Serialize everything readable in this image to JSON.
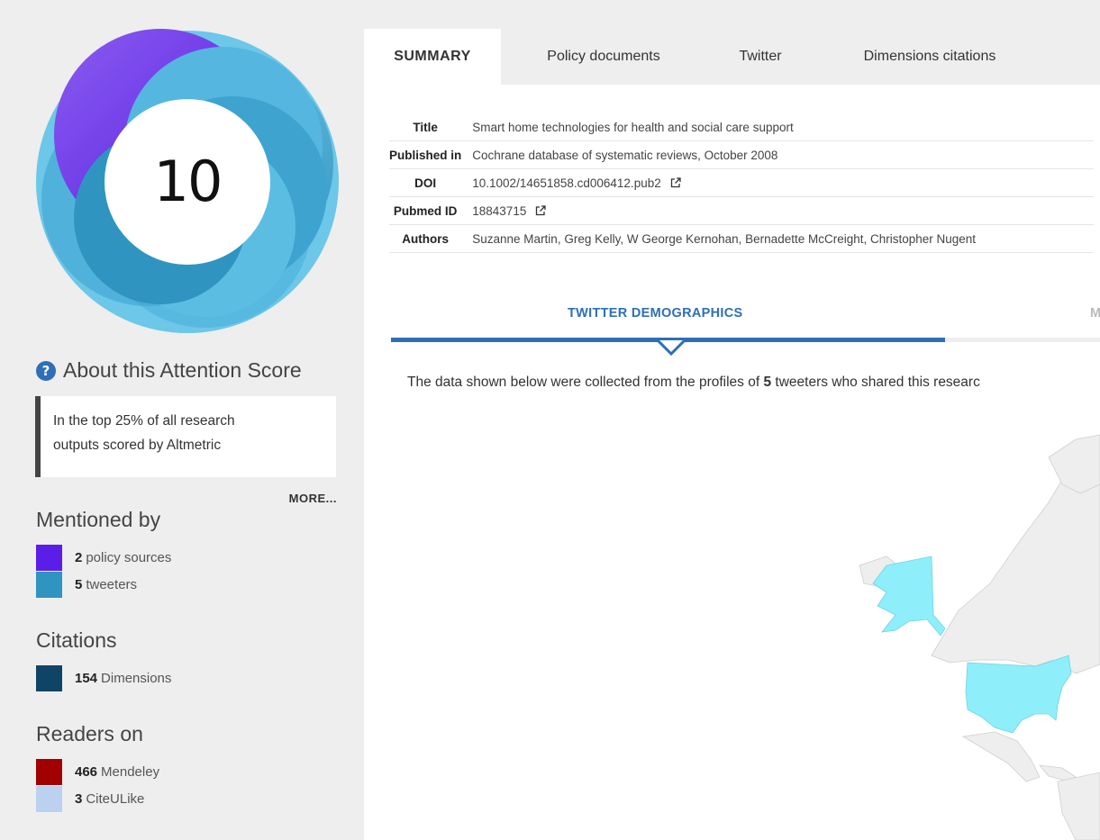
{
  "score": {
    "value": "10"
  },
  "about": {
    "icon": "question-circle-icon",
    "label": "About this Attention Score"
  },
  "rank": {
    "text_line1": "In the top 25% of all research",
    "text_line2": "outputs scored by Altmetric"
  },
  "more_label": "MORE...",
  "mentioned": {
    "title": "Mentioned by",
    "items": [
      {
        "count": "2",
        "label": "policy sources",
        "color": "#5b1ee8"
      },
      {
        "count": "5",
        "label": "tweeters",
        "color": "#2f95c0"
      }
    ]
  },
  "citations": {
    "title": "Citations",
    "items": [
      {
        "count": "154",
        "label": "Dimensions",
        "color": "#0f4467"
      }
    ]
  },
  "readers": {
    "title": "Readers on",
    "items": [
      {
        "count": "466",
        "label": "Mendeley",
        "color": "#a10000"
      },
      {
        "count": "3",
        "label": "CiteULike",
        "color": "#bad1f0"
      }
    ]
  },
  "tabs": [
    {
      "label": "SUMMARY"
    },
    {
      "label": "Policy documents"
    },
    {
      "label": "Twitter"
    },
    {
      "label": "Dimensions citations"
    }
  ],
  "meta": {
    "title_key": "Title",
    "title_val": "Smart home technologies for health and social care support",
    "published_key": "Published in",
    "published_val": "Cochrane database of systematic reviews, October 2008",
    "doi_key": "DOI",
    "doi_val": "10.1002/14651858.cd006412.pub2",
    "pubmed_key": "Pubmed ID",
    "pubmed_val": "18843715",
    "authors_key": "Authors",
    "authors_val": "Suzanne Martin, Greg Kelly, W George Kernohan, Bernadette McCreight, Christopher Nugent"
  },
  "demographics": {
    "tab_label": "TWITTER DEMOGRAPHICS",
    "tab2_label": "M",
    "intro_pre": "The data shown below were collected from the profiles of ",
    "intro_count": "5",
    "intro_post": " tweeters who shared this researc"
  },
  "colors": {
    "accent": "#2e6fb7",
    "map_highlight": "#8eeefa",
    "map_land": "#eeeeee"
  }
}
